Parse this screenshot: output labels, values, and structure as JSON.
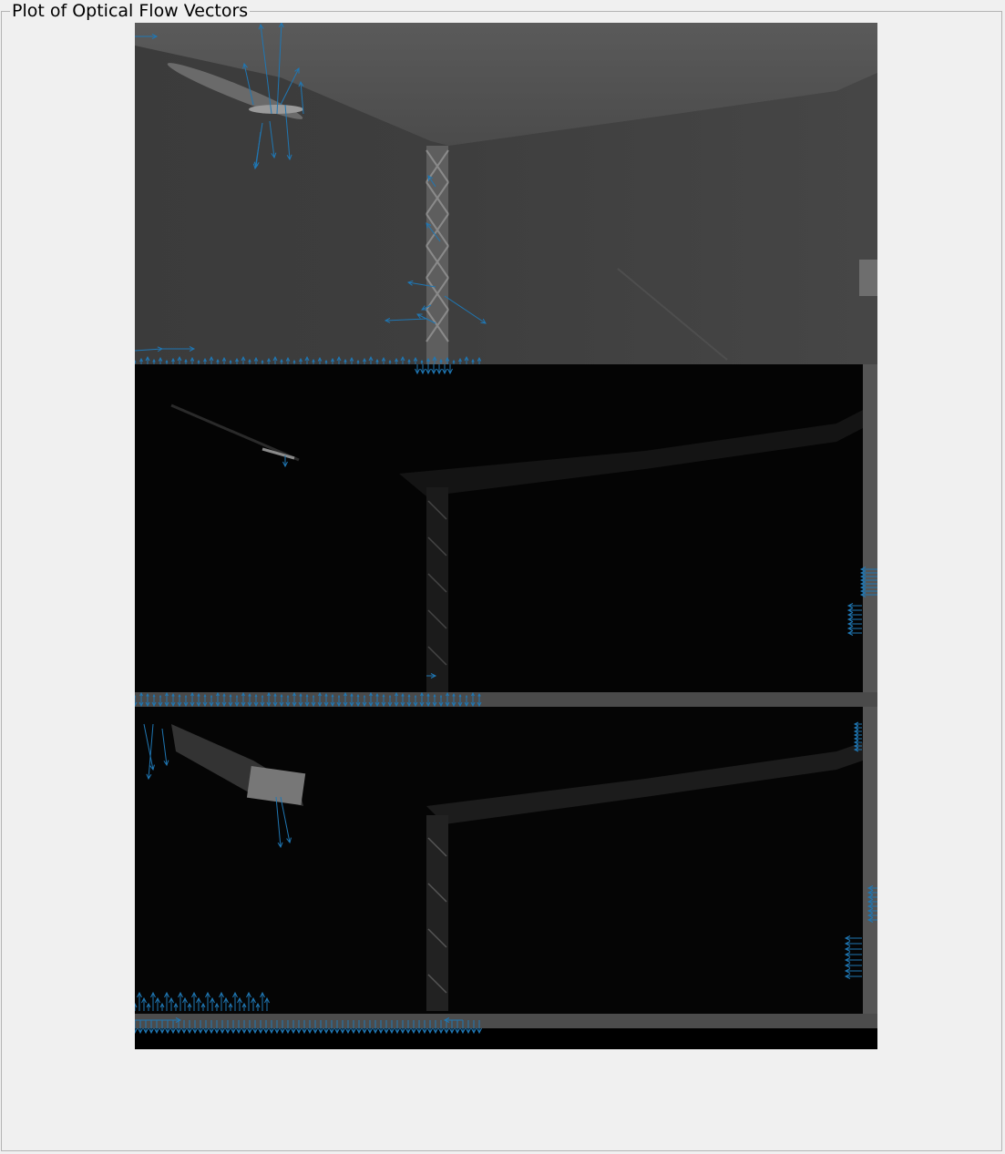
{
  "panel": {
    "title": "Plot of Optical Flow Vectors"
  },
  "plot": {
    "content": "optical flow frames stacked vertically with quiver overlay",
    "vector_color": "#1f77b4",
    "frames": [
      {
        "name": "frame-1",
        "tone": "grayscale camera image of room corner with ceiling lamp and lattice mast"
      },
      {
        "name": "frame-2",
        "tone": "dark difference image"
      },
      {
        "name": "frame-3",
        "tone": "dark difference image"
      }
    ]
  }
}
